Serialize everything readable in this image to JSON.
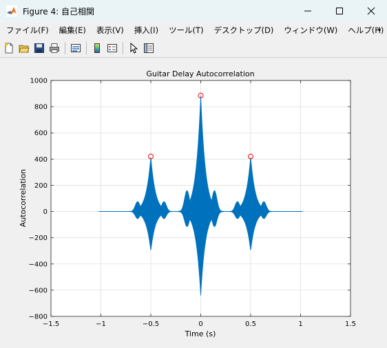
{
  "window": {
    "title": "Figure 4: 自己相関",
    "icons": [
      "matlab-logo-icon",
      "minimize-icon",
      "maximize-icon",
      "close-icon"
    ]
  },
  "menu": {
    "items": [
      "ファイル(F)",
      "編集(E)",
      "表示(V)",
      "挿入(I)",
      "ツール(T)",
      "デスクトップ(D)",
      "ウィンドウ(W)",
      "ヘルプ(H)"
    ],
    "overflow_icon": "arrow-icon"
  },
  "toolbar": {
    "icons": [
      "new-figure-icon",
      "open-file-icon",
      "save-icon",
      "print-icon",
      "link-plot-icon",
      "colorbar-icon",
      "legend-icon",
      "edit-plot-icon",
      "property-inspector-icon"
    ]
  },
  "chart_data": {
    "type": "line",
    "title": "Guitar Delay Autocorrelation",
    "xlabel": "Time (s)",
    "ylabel": "Autocorrelation",
    "xlim": [
      -1.5,
      1.5
    ],
    "ylim": [
      -800,
      1000
    ],
    "xticks": [
      "−1.5",
      "−1",
      "−0.5",
      "0",
      "0.5",
      "1",
      "1.5"
    ],
    "xtick_values": [
      -1.5,
      -1,
      -0.5,
      0,
      0.5,
      1,
      1.5
    ],
    "yticks": [
      "−800",
      "−600",
      "−400",
      "−200",
      "0",
      "200",
      "400",
      "600",
      "800",
      "1000"
    ],
    "ytick_values": [
      -800,
      -600,
      -400,
      -200,
      0,
      200,
      400,
      600,
      800,
      1000
    ],
    "grid": true,
    "line_color": "#0072bd",
    "marker_color": "#ff0000",
    "series": [
      {
        "style": "envelope",
        "data_range": [
          -1.02,
          1.02
        ],
        "lobes": [
          {
            "center": -0.5,
            "max": 420,
            "min": -300,
            "width": 0.24
          },
          {
            "center": 0,
            "max": 885,
            "min": -640,
            "width": 0.25
          },
          {
            "center": 0.5,
            "max": 420,
            "min": -300,
            "width": 0.24
          }
        ]
      }
    ],
    "peaks": [
      {
        "x": -0.5,
        "y": 420
      },
      {
        "x": 0,
        "y": 885
      },
      {
        "x": 0.5,
        "y": 420
      }
    ]
  }
}
